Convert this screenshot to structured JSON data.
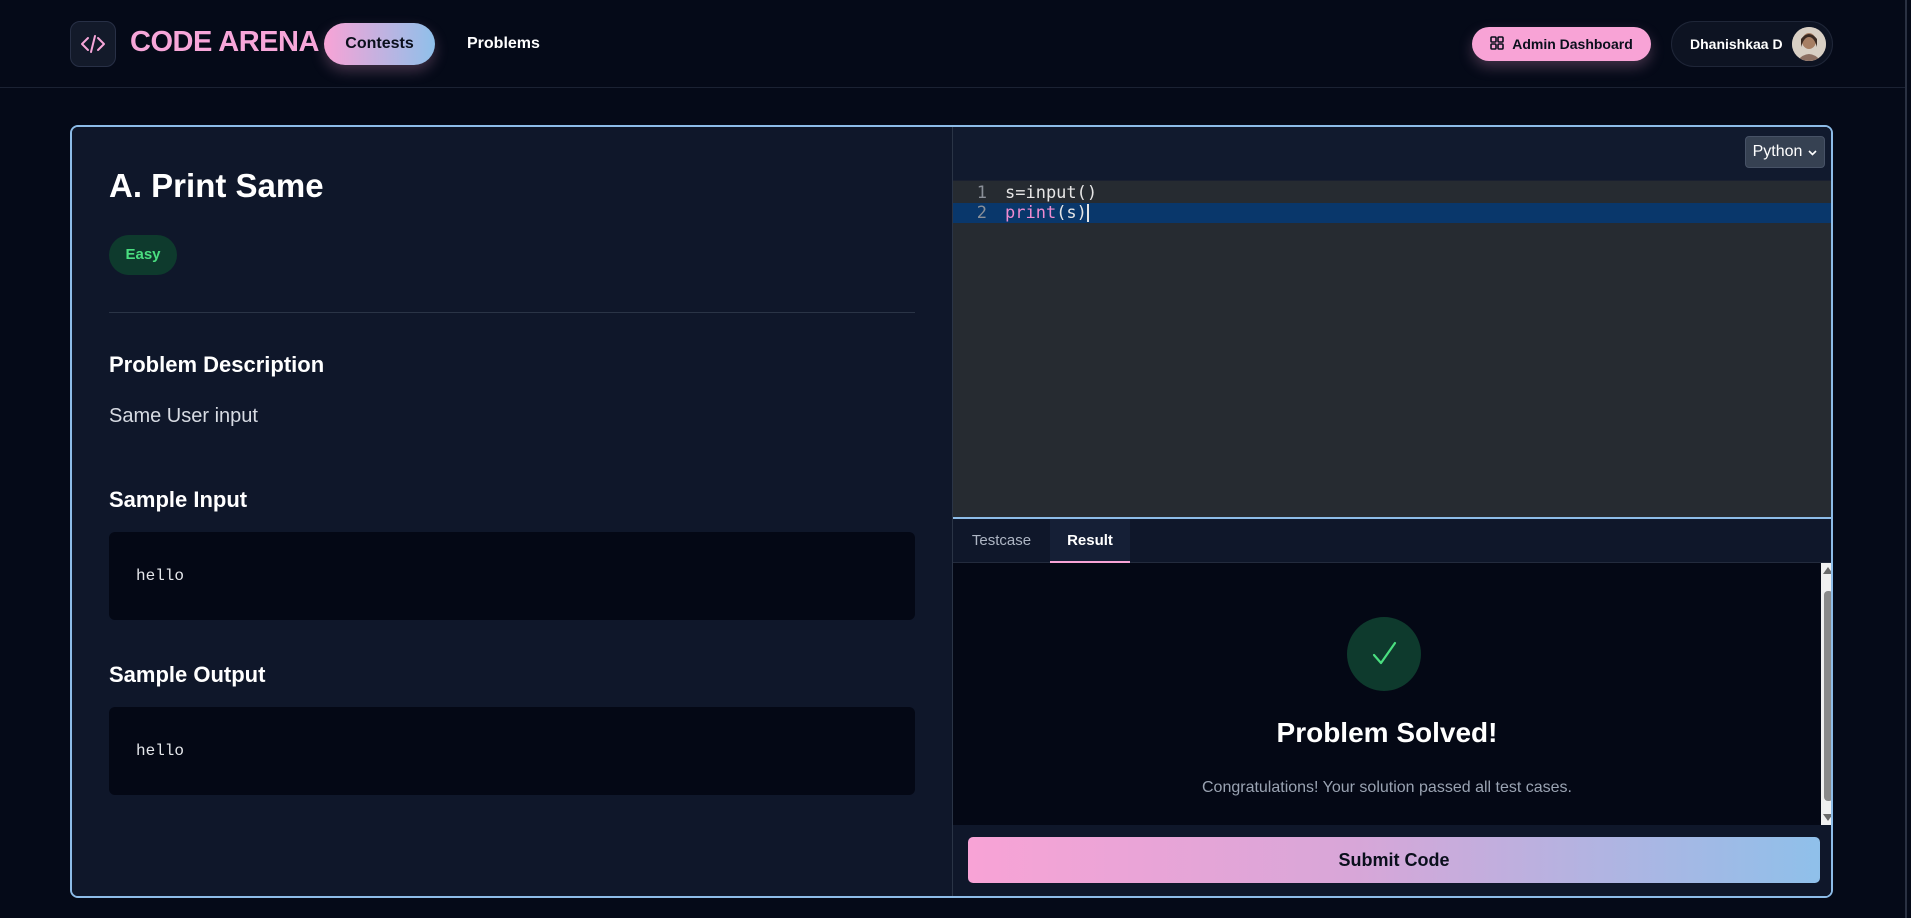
{
  "navbar": {
    "brand": "CODE ARENA",
    "nav_items": [
      "Contests",
      "Problems"
    ],
    "active_nav": "Contests",
    "admin_button": "Admin Dashboard",
    "user_name": "Dhanishkaa D"
  },
  "problem": {
    "title": "A. Print Same",
    "difficulty": "Easy",
    "description_heading": "Problem Description",
    "description": "Same User input",
    "sample_input_heading": "Sample Input",
    "sample_input": "hello",
    "sample_output_heading": "Sample Output",
    "sample_output": "hello"
  },
  "editor": {
    "language": "Python",
    "lines": [
      {
        "number": "1",
        "code": "s=input()"
      },
      {
        "number": "2",
        "keyword": "print",
        "rest": "(s)"
      }
    ]
  },
  "result_panel": {
    "tabs": [
      "Testcase",
      "Result"
    ],
    "active_tab": "Result",
    "status_icon": "check-icon",
    "title": "Problem Solved!",
    "message": "Congratulations! Your solution passed all test cases."
  },
  "submit_button": "Submit Code",
  "colors": {
    "accent_pink": "#f8a3d6",
    "accent_blue": "#8fc0ea",
    "success_green": "#4ade80",
    "background": "#050a18",
    "card": "#0f172a"
  }
}
